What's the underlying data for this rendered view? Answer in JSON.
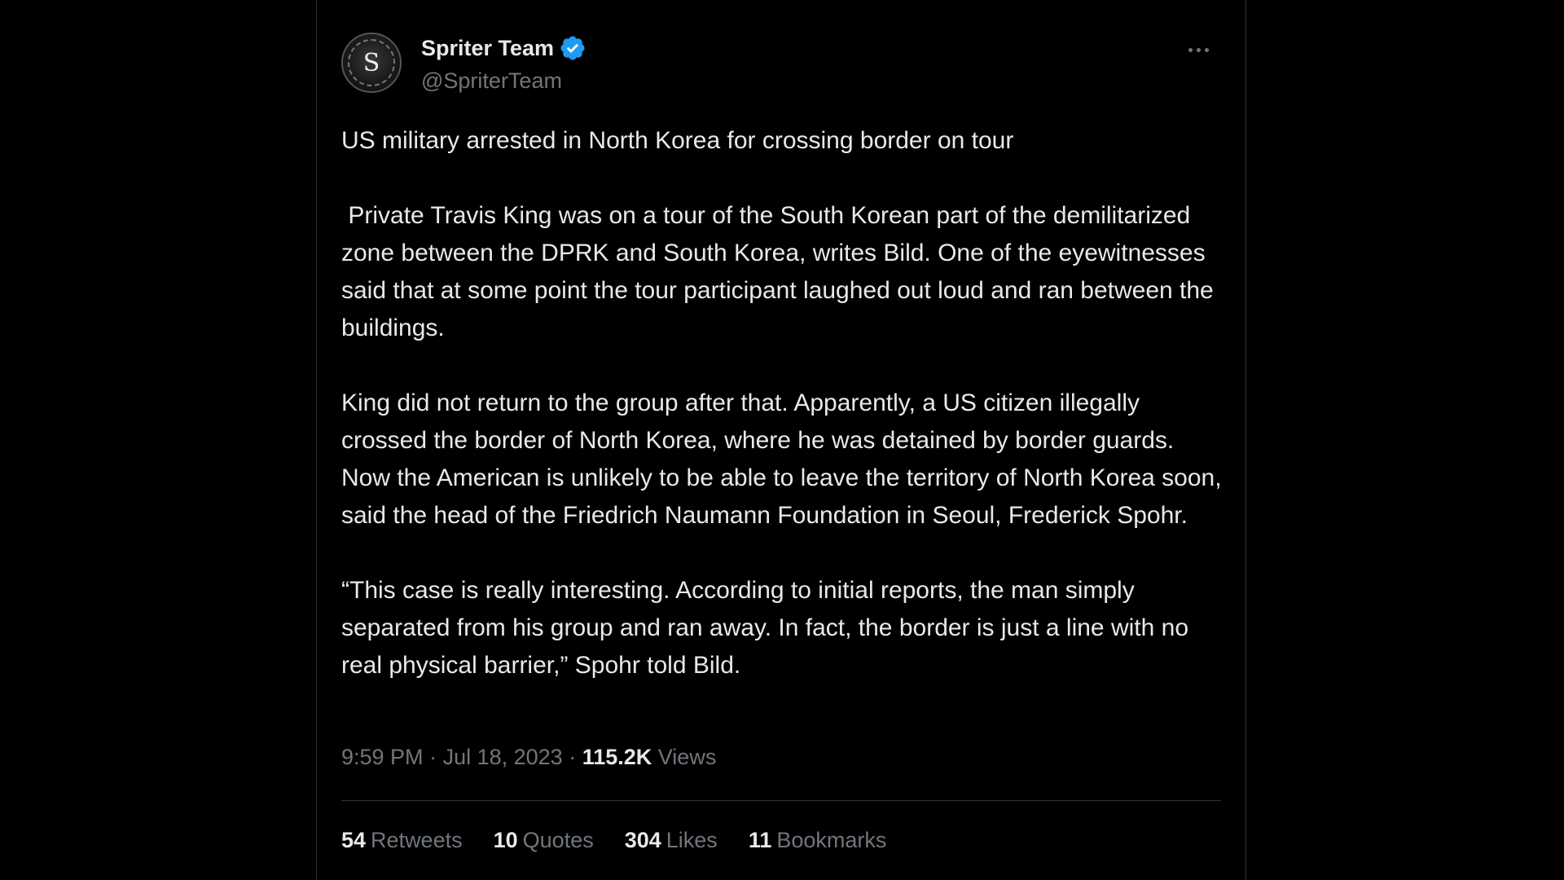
{
  "author": {
    "display_name": "Spriter Team",
    "handle": "@SpriterTeam",
    "avatar_letter": "S",
    "verified": true,
    "verified_color": "#1d9bf0"
  },
  "tweet": {
    "paragraphs": [
      "US military arrested in North Korea for crossing border on tour",
      " Private Travis King was on a tour of the South Korean part of the demilitarized zone between the DPRK and South Korea, writes Bild. One of the eyewitnesses said that at some point the tour participant laughed out loud and ran between the buildings.",
      "King did not return to the group after that. Apparently, a US citizen illegally crossed the border of North Korea, where he was detained by border guards. Now the American is unlikely to be able to leave the territory of North Korea soon, said the head of the Friedrich Naumann Foundation in Seoul, Frederick Spohr.",
      "“This case is really interesting. According to initial reports, the man simply separated from his group and ran away. In fact, the border is just a line with no real physical barrier,” Spohr told Bild."
    ],
    "time": "9:59 PM",
    "separator": " · ",
    "date": "Jul 18, 2023",
    "views_count": "115.2K",
    "views_label": "Views"
  },
  "stats": {
    "retweets": {
      "count": "54",
      "label": "Retweets"
    },
    "quotes": {
      "count": "10",
      "label": "Quotes"
    },
    "likes": {
      "count": "304",
      "label": "Likes"
    },
    "bookmarks": {
      "count": "11",
      "label": "Bookmarks"
    }
  },
  "icons": {
    "verified": "verified-badge-icon",
    "more": "more-dots-icon"
  }
}
